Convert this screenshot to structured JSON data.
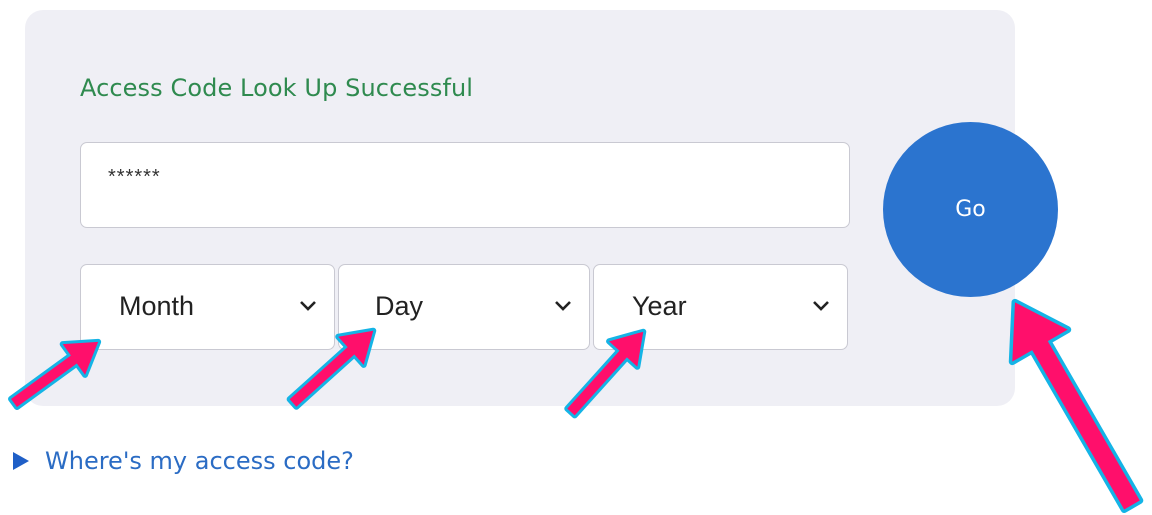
{
  "form": {
    "status_message": "Access Code Look Up Successful",
    "access_code_value": "******",
    "month": {
      "label": "Month",
      "icon": "chevron-down-icon"
    },
    "day": {
      "label": "Day",
      "icon": "chevron-down-icon"
    },
    "year": {
      "label": "Year",
      "icon": "chevron-down-icon"
    },
    "go_label": "Go"
  },
  "help": {
    "link_label": "Where's my access code?",
    "icon": "disclosure-triangle-icon"
  },
  "colors": {
    "panel_bg": "#efeff5",
    "status_green": "#2f8a4f",
    "button_blue": "#2b74cf",
    "link_blue": "#2b6cc4",
    "arrow_fill": "#ff0f6b",
    "arrow_outline": "#14b4e6"
  }
}
